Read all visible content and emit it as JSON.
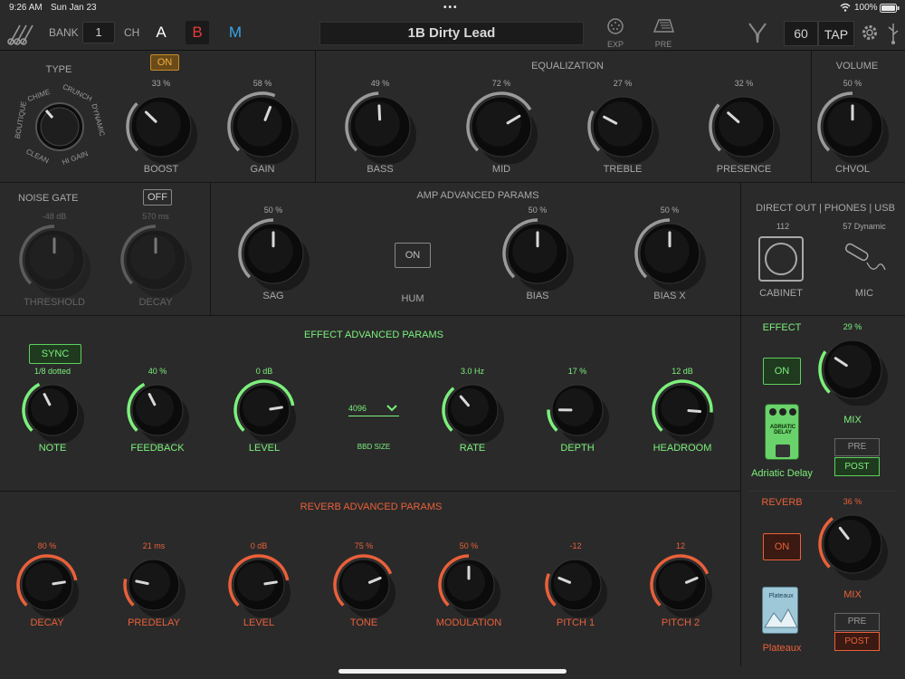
{
  "status": {
    "time": "9:26 AM",
    "date": "Sun Jan 23",
    "battery": "100%"
  },
  "topbar": {
    "bank_label": "BANK",
    "bank_value": "1",
    "ch_label": "CH",
    "channels": [
      "A",
      "B",
      "M"
    ],
    "preset_name": "1B Dirty Lead",
    "exp_label": "EXP",
    "pre_label": "PRE",
    "tempo": "60",
    "tap_label": "TAP"
  },
  "amp": {
    "type_title": "TYPE",
    "type_labels": [
      "CHIME",
      "CRUNCH",
      "BOUTIQUE",
      "DYNAMIC",
      "CLEAN",
      "HI GAIN"
    ],
    "boost_toggle": "ON",
    "boost": {
      "pct": "33 %",
      "label": "BOOST",
      "value": 0.33
    },
    "gain": {
      "pct": "58 %",
      "label": "GAIN",
      "value": 0.58
    }
  },
  "eq": {
    "title": "EQUALIZATION",
    "knobs": [
      {
        "pct": "49 %",
        "label": "BASS",
        "value": 0.49
      },
      {
        "pct": "72 %",
        "label": "MID",
        "value": 0.72
      },
      {
        "pct": "27 %",
        "label": "TREBLE",
        "value": 0.27
      },
      {
        "pct": "32 %",
        "label": "PRESENCE",
        "value": 0.32
      }
    ]
  },
  "volume": {
    "title": "VOLUME",
    "pct": "50 %",
    "label": "CHVOL",
    "value": 0.5
  },
  "noise_gate": {
    "title": "NOISE GATE",
    "toggle": "OFF",
    "threshold": {
      "pct": "-48 dB",
      "label": "THRESHOLD",
      "value": 0.5
    },
    "decay": {
      "pct": "570 ms",
      "label": "DECAY",
      "value": 0.5
    }
  },
  "amp_adv": {
    "title": "AMP ADVANCED PARAMS",
    "sag": {
      "pct": "50 %",
      "label": "SAG",
      "value": 0.5
    },
    "hum_toggle": "ON",
    "hum_label": "HUM",
    "bias": {
      "pct": "50 %",
      "label": "BIAS",
      "value": 0.5
    },
    "biasx": {
      "pct": "50 %",
      "label": "BIAS X",
      "value": 0.5
    }
  },
  "direct_out": {
    "title": "DIRECT OUT | PHONES | USB",
    "cab_value": "112",
    "cab_label": "CABINET",
    "mic_value": "57 Dynamic",
    "mic_label": "MIC"
  },
  "effect_adv": {
    "title": "EFFECT ADVANCED PARAMS",
    "sync_label": "SYNC",
    "note": {
      "pct": "1/8 dotted",
      "label": "NOTE",
      "value": 0.4
    },
    "feedback": {
      "pct": "40 %",
      "label": "FEEDBACK",
      "value": 0.4
    },
    "level": {
      "pct": "0 dB",
      "label": "LEVEL",
      "value": 0.8
    },
    "bbd_value": "4096",
    "bbd_label": "BBD SIZE",
    "rate": {
      "pct": "3.0 Hz",
      "label": "RATE",
      "value": 0.35
    },
    "depth": {
      "pct": "17 %",
      "label": "DEPTH",
      "value": 0.17
    },
    "headroom": {
      "pct": "12 dB",
      "label": "HEADROOM",
      "value": 0.85
    }
  },
  "effect": {
    "title": "EFFECT",
    "toggle": "ON",
    "mix": {
      "pct": "29 %",
      "label": "MIX",
      "value": 0.29
    },
    "pedal_name": "Adriatic Delay",
    "pedal_text": "ADRIATIC DELAY",
    "pre": "PRE",
    "post": "POST"
  },
  "reverb_adv": {
    "title": "REVERB ADVANCED PARAMS",
    "knobs": [
      {
        "pct": "80 %",
        "label": "DECAY",
        "value": 0.8
      },
      {
        "pct": "21 ms",
        "label": "PREDELAY",
        "value": 0.21
      },
      {
        "pct": "0 dB",
        "label": "LEVEL",
        "value": 0.8
      },
      {
        "pct": "75 %",
        "label": "TONE",
        "value": 0.75
      },
      {
        "pct": "50 %",
        "label": "MODULATION",
        "value": 0.5
      },
      {
        "pct": "-12",
        "label": "PITCH 1",
        "value": 0.25
      },
      {
        "pct": "12",
        "label": "PITCH 2",
        "value": 0.75
      }
    ]
  },
  "reverb": {
    "title": "REVERB",
    "toggle": "ON",
    "mix": {
      "pct": "36 %",
      "label": "MIX",
      "value": 0.36
    },
    "pedal_name": "Plateaux",
    "pedal_text": "Plateaux",
    "pre": "PRE",
    "post": "POST"
  },
  "colors": {
    "bg": "#2a2a2a",
    "effect_green": "#7cf07c",
    "reverb_orange": "#e9603a",
    "channel_b": "#e23b3b",
    "channel_m": "#3aa3e8"
  }
}
